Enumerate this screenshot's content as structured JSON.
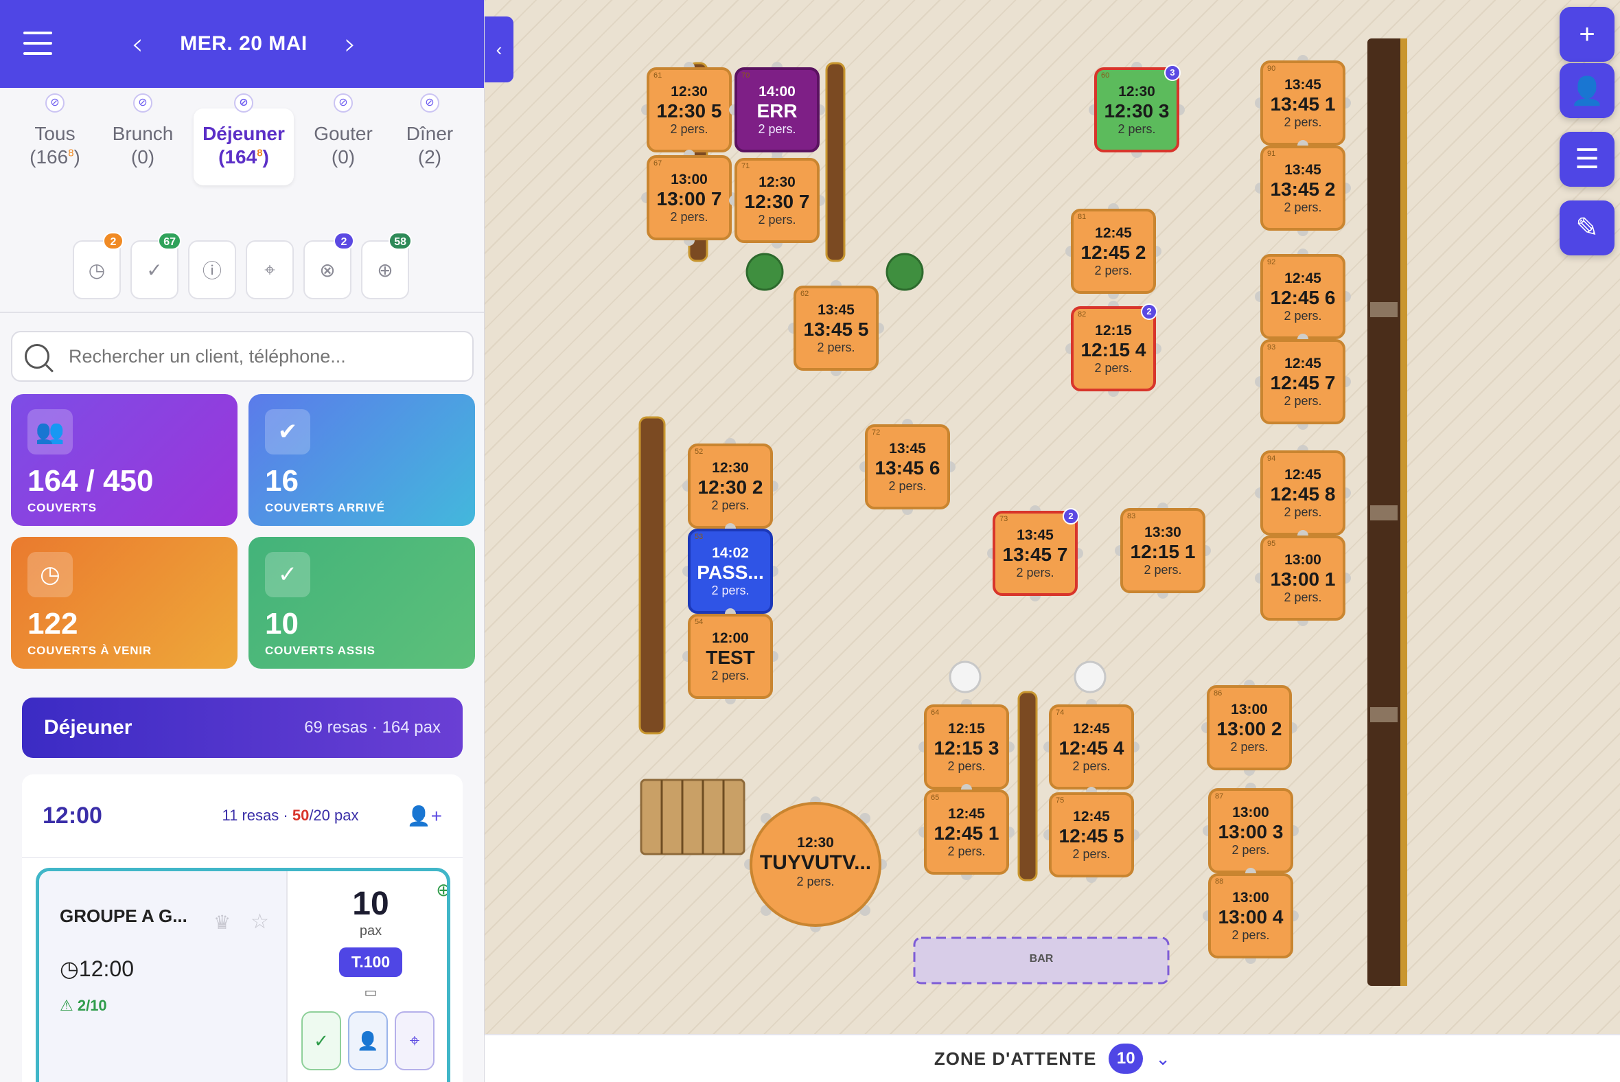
{
  "header": {
    "date": "MER. 20 MAI",
    "prev_icon": "chevron-left-icon",
    "next_icon": "chevron-right-icon",
    "menu_icon": "hamburger-icon"
  },
  "services": [
    {
      "name": "Tous",
      "count": "(166",
      "extra": "8",
      "close": ")"
    },
    {
      "name": "Brunch",
      "count": "(0)",
      "extra": "",
      "close": ""
    },
    {
      "name": "Déjeuner",
      "count": "(164",
      "extra": "8",
      "close": ")"
    },
    {
      "name": "Gouter",
      "count": "(0)",
      "extra": "",
      "close": ""
    },
    {
      "name": "Dîner",
      "count": "(2)",
      "extra": "",
      "close": ""
    }
  ],
  "filters": [
    {
      "icon": "clock-icon",
      "badge": "2",
      "badge_color": "#f08a24"
    },
    {
      "icon": "check-circle-icon",
      "badge": "67",
      "badge_color": "#2fa25a"
    },
    {
      "icon": "alert-circle-icon",
      "badge": "",
      "badge_color": ""
    },
    {
      "icon": "location-pin-icon",
      "badge": "",
      "badge_color": ""
    },
    {
      "icon": "location-off-icon",
      "badge": "2",
      "badge_color": "#5b49e2"
    },
    {
      "icon": "globe-icon",
      "badge": "58",
      "badge_color": "#2e8a58"
    }
  ],
  "search": {
    "placeholder": "Rechercher un client, téléphone..."
  },
  "stats": {
    "couverts": {
      "value": "164 / 450",
      "label": "COUVERTS"
    },
    "arrive": {
      "value": "16",
      "label": "COUVERTS ARRIVÉ"
    },
    "avenir": {
      "value": "122",
      "label": "COUVERTS À VENIR"
    },
    "assis": {
      "value": "10",
      "label": "COUVERTS ASSIS"
    }
  },
  "service_banner": {
    "title": "Déjeuner",
    "meta": "69 resas · 164 pax"
  },
  "slot": {
    "time": "12:00",
    "resas": "11 resas · ",
    "pax_over": "50",
    "pax_rest": "/20 pax"
  },
  "reservation": {
    "name": "GROUPE A G...",
    "time": "12:00",
    "warning": "2/10",
    "pax": "10",
    "pax_label": "pax",
    "table": "T.100"
  },
  "floor": {
    "tables": [
      {
        "id": "61",
        "time": "12:30",
        "name": "12:30 5",
        "pax": "2 pers.",
        "status": "orange"
      },
      {
        "id": "67",
        "time": "13:00",
        "name": "13:00 7",
        "pax": "2 pers.",
        "status": "orange"
      },
      {
        "id": "70",
        "time": "14:00",
        "name": "ERR",
        "pax": "2 pers.",
        "status": "purple"
      },
      {
        "id": "71",
        "time": "12:30",
        "name": "12:30 7",
        "pax": "2 pers.",
        "status": "orange"
      },
      {
        "id": "62",
        "time": "13:45",
        "name": "13:45 5",
        "pax": "2 pers.",
        "status": "orange"
      },
      {
        "id": "60",
        "time": "12:30",
        "name": "12:30 3",
        "pax": "2 pers.",
        "status": "green",
        "badge": "3"
      },
      {
        "id": "81",
        "time": "12:45",
        "name": "12:45 2",
        "pax": "2 pers.",
        "status": "orange"
      },
      {
        "id": "82",
        "time": "12:15",
        "name": "12:15 4",
        "pax": "2 pers.",
        "status": "orange-red",
        "badge": "2"
      },
      {
        "id": "90",
        "time": "13:45",
        "name": "13:45 1",
        "pax": "2 pers.",
        "status": "orange"
      },
      {
        "id": "91",
        "time": "13:45",
        "name": "13:45 2",
        "pax": "2 pers.",
        "status": "orange"
      },
      {
        "id": "92",
        "time": "12:45",
        "name": "12:45 6",
        "pax": "2 pers.",
        "status": "orange"
      },
      {
        "id": "93",
        "time": "12:45",
        "name": "12:45 7",
        "pax": "2 pers.",
        "status": "orange"
      },
      {
        "id": "94",
        "time": "12:45",
        "name": "12:45 8",
        "pax": "2 pers.",
        "status": "orange"
      },
      {
        "id": "95",
        "time": "13:00",
        "name": "13:00 1",
        "pax": "2 pers.",
        "status": "orange"
      },
      {
        "id": "52",
        "time": "12:30",
        "name": "12:30 2",
        "pax": "2 pers.",
        "status": "orange"
      },
      {
        "id": "53",
        "time": "14:02",
        "name": "PASS...",
        "pax": "2 pers.",
        "status": "blue"
      },
      {
        "id": "54",
        "time": "12:00",
        "name": "TEST",
        "pax": "2 pers.",
        "status": "orange"
      },
      {
        "id": "72",
        "time": "13:45",
        "name": "13:45 6",
        "pax": "2 pers.",
        "status": "orange"
      },
      {
        "id": "73",
        "time": "13:45",
        "name": "13:45 7",
        "pax": "2 pers.",
        "status": "orange-red",
        "badge": "2"
      },
      {
        "id": "83",
        "time": "13:30",
        "name": "12:15 1",
        "pax": "2 pers.",
        "status": "orange"
      },
      {
        "id": "64",
        "time": "12:15",
        "name": "12:15 3",
        "pax": "2 pers.",
        "status": "orange"
      },
      {
        "id": "65",
        "time": "12:45",
        "name": "12:45 1",
        "pax": "2 pers.",
        "status": "orange"
      },
      {
        "id": "74",
        "time": "12:45",
        "name": "12:45 4",
        "pax": "2 pers.",
        "status": "orange"
      },
      {
        "id": "75",
        "time": "12:45",
        "name": "12:45 5",
        "pax": "2 pers.",
        "status": "orange"
      },
      {
        "id": "86",
        "time": "13:00",
        "name": "13:00 2",
        "pax": "2 pers.",
        "status": "orange"
      },
      {
        "id": "87",
        "time": "13:00",
        "name": "13:00 3",
        "pax": "2 pers.",
        "status": "orange"
      },
      {
        "id": "88",
        "time": "13:00",
        "name": "13:00 4",
        "pax": "2 pers.",
        "status": "orange"
      },
      {
        "id": "",
        "time": "12:30",
        "name": "TUYVUTV...",
        "pax": "2 pers.",
        "status": "orange",
        "round": true
      }
    ],
    "bar_label": "BAR"
  },
  "fabs": [
    "plus-icon",
    "add-user-icon",
    "filter-icon",
    "edit-icon"
  ],
  "waiting_zone": {
    "label": "ZONE D'ATTENTE",
    "count": "10"
  },
  "colors": {
    "primary": "#4f46e5",
    "orange": "#f3a04d",
    "green": "#5cbb5c",
    "purple": "#7e1f86",
    "blue": "#2f54e6",
    "red_border": "#d8352b"
  }
}
